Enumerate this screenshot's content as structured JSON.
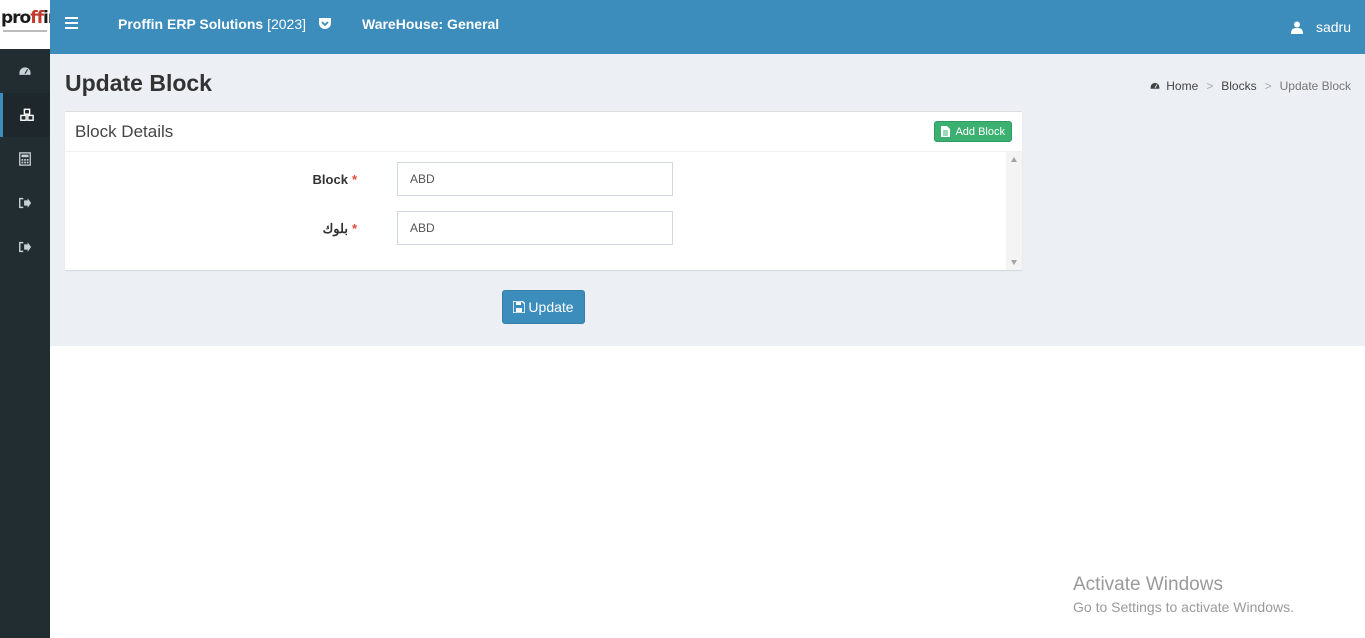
{
  "logo": {
    "text_prefix": "pro",
    "text_ff": "ff",
    "text_suffix": "in"
  },
  "topbar": {
    "app_title": "Proffin ERP Solutions",
    "app_year": "[2023]",
    "warehouse": "WareHouse: General",
    "username": "sadru"
  },
  "sidebar": {
    "items": [
      {
        "icon": "dashboard-icon"
      },
      {
        "icon": "cubes-icon",
        "active": true
      },
      {
        "icon": "calculator-icon"
      },
      {
        "icon": "sign-out-icon"
      },
      {
        "icon": "sign-out-icon"
      }
    ]
  },
  "page": {
    "title": "Update Block",
    "breadcrumb": [
      "Home",
      "Blocks",
      "Update Block"
    ]
  },
  "box": {
    "title": "Block Details",
    "add_button": "Add Block"
  },
  "form": {
    "block_label": "Block",
    "block_value": "ABD",
    "arabic_label": "بلوك",
    "arabic_value": "ABD",
    "required_mark": "*",
    "update_button": "Update"
  },
  "watermark": {
    "title": "Activate Windows",
    "subtitle": "Go to Settings to activate Windows."
  },
  "colors": {
    "primary": "#3c8dbc",
    "sidebar": "#222d32",
    "success": "#3bb071",
    "danger": "#dd4b39",
    "content_bg": "#ecf0f5"
  }
}
